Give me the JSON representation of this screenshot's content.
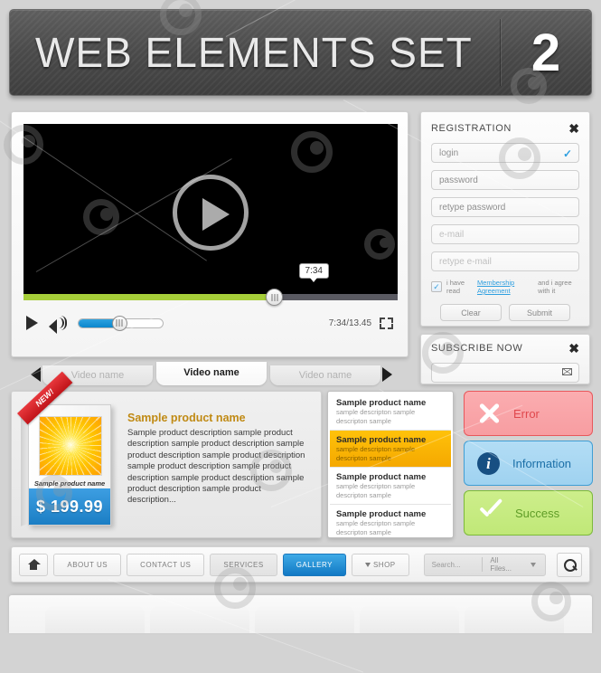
{
  "header": {
    "title": "WEB ELEMENTS SET",
    "number": "2"
  },
  "video": {
    "play_icon": "play-triangle-icon",
    "tooltip_time": "7:34",
    "progress_percent": 67,
    "progress_color": "#a6ce39",
    "volume_percent": 48,
    "volume_color": "#0b86cd",
    "time_display": "7:34/13.45",
    "play_button_icon": "play-icon",
    "volume_icon": "speaker-icon",
    "fullscreen_icon": "fullscreen-icon",
    "tabs": [
      {
        "label": "Video name",
        "active": false
      },
      {
        "label": "Video name",
        "active": true
      },
      {
        "label": "Video name",
        "active": false
      }
    ],
    "prev_icon": "chevron-left-icon",
    "next_icon": "chevron-right-icon"
  },
  "registration": {
    "title": "REGISTRATION",
    "close_icon": "close-icon",
    "fields": [
      {
        "value": "login",
        "dim": false,
        "valid": true
      },
      {
        "value": "password",
        "dim": false,
        "valid": false
      },
      {
        "value": "retype password",
        "dim": false,
        "valid": false
      },
      {
        "value": "e-mail",
        "dim": true,
        "valid": false
      },
      {
        "value": "retype e-mail",
        "dim": true,
        "valid": false
      }
    ],
    "check_icon": "checkmark-icon",
    "agree_checked": true,
    "agree_pre": "i have read",
    "agree_link": "Membership Agreement",
    "agree_post": "and i agree with it",
    "clear_label": "Clear",
    "submit_label": "Submit"
  },
  "subscribe": {
    "title": "SUBSCRIBE NOW",
    "close_icon": "close-icon",
    "input_value": "",
    "mail_icon": "envelope-icon"
  },
  "alerts": [
    {
      "label": "Error",
      "icon": "cross-icon",
      "class": "alert-err",
      "color": "#e0484d"
    },
    {
      "label": "Information",
      "icon": "info-icon",
      "class": "alert-inf",
      "color": "#1b6fa8"
    },
    {
      "label": "Success",
      "icon": "check-icon",
      "class": "alert-suc",
      "color": "#5f9c27"
    }
  ],
  "product": {
    "ribbon": "NEW!",
    "box_label": "Sample product name",
    "price": "$ 199.99",
    "name": "Sample product name",
    "description": "Sample product description sample product description sample product description sample product description sample product description sample product description sample product description sample product description sample product description sample product description..."
  },
  "product_list": [
    {
      "title": "Sample product name",
      "sub": "sample descripton sample descripton sample",
      "selected": false
    },
    {
      "title": "Sample product name",
      "sub": "sample descripton sample descripton sample",
      "selected": true
    },
    {
      "title": "Sample product name",
      "sub": "sample descripton sample descripton sample",
      "selected": false
    },
    {
      "title": "Sample product name",
      "sub": "sample descripton sample descripton sample",
      "selected": false
    }
  ],
  "bottom_nav": {
    "home_icon": "home-icon",
    "items": [
      {
        "label": "ABOUT US",
        "active": false,
        "style": ""
      },
      {
        "label": "CONTACT US",
        "active": false,
        "style": ""
      },
      {
        "label": "SERVICES",
        "active": false,
        "style": "services"
      },
      {
        "label": "GALLERY",
        "active": true,
        "style": ""
      },
      {
        "label": "SHOP",
        "active": false,
        "style": "caret"
      }
    ],
    "search_placeholder": "Search...",
    "filter_value": "All Files...",
    "filter_caret_icon": "chevron-down-icon",
    "search_icon": "search-icon"
  },
  "colors": {
    "page_bg": "#d3d3d3",
    "accent_blue": "#1279c4",
    "accent_gold": "#f5a800",
    "accent_green": "#a6ce39"
  }
}
